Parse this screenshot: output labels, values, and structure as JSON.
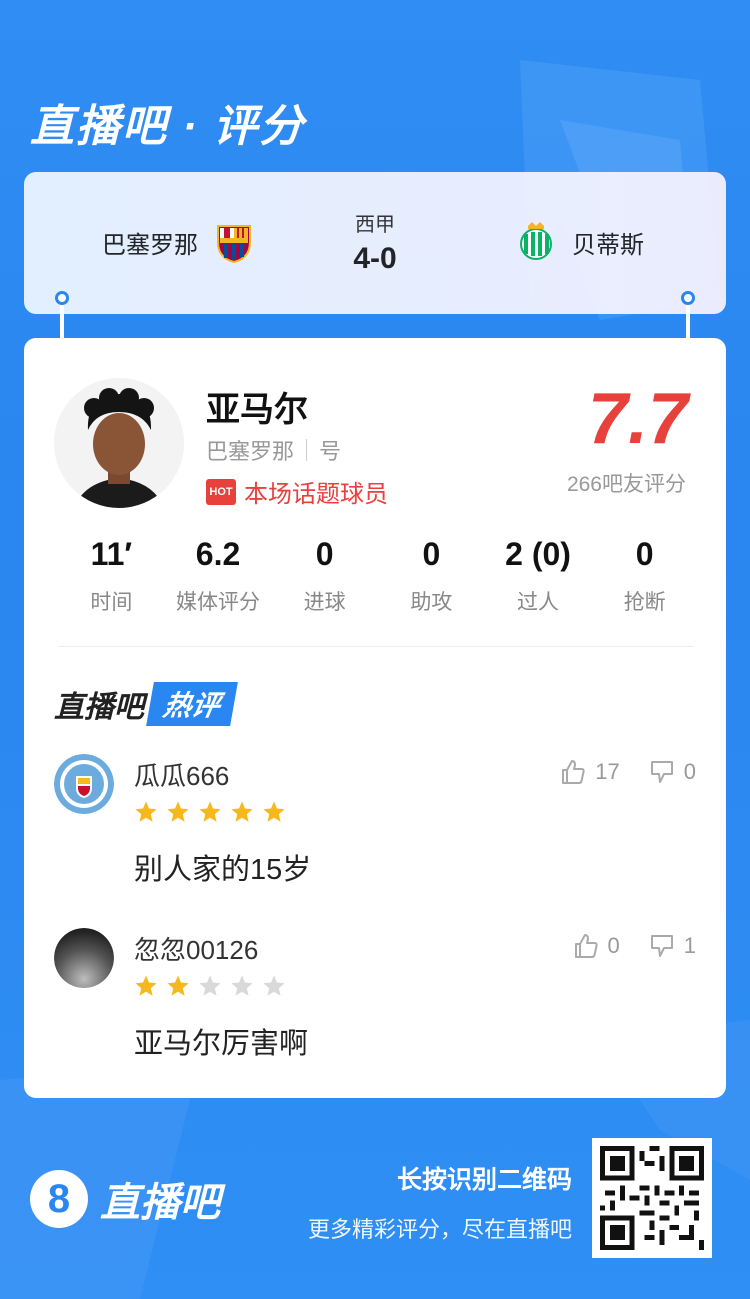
{
  "header": {
    "title": "直播吧 · 评分"
  },
  "match": {
    "home_team": "巴塞罗那",
    "away_team": "贝蒂斯",
    "league": "西甲",
    "score": "4-0"
  },
  "player": {
    "name": "亚马尔",
    "team": "巴塞罗那",
    "number_label": "号",
    "hot_badge": "HOT",
    "hot_text": "本场话题球员",
    "rating": "7.7",
    "rating_count": "266吧友评分"
  },
  "stats": [
    {
      "value": "11′",
      "label": "时间"
    },
    {
      "value": "6.2",
      "label": "媒体评分"
    },
    {
      "value": "0",
      "label": "进球"
    },
    {
      "value": "0",
      "label": "助攻"
    },
    {
      "value": "2 (0)",
      "label": "过人"
    },
    {
      "value": "0",
      "label": "抢断"
    }
  ],
  "hot_comments": {
    "title_main": "直播吧",
    "title_tag": "热评",
    "items": [
      {
        "user": "瓜瓜666",
        "stars": 5,
        "text": "别人家的15岁",
        "likes": "17",
        "dislikes": "0"
      },
      {
        "user": "忽忽00126",
        "stars": 2,
        "text": "亚马尔厉害啊",
        "likes": "0",
        "dislikes": "1"
      }
    ]
  },
  "footer": {
    "logo_number": "8",
    "logo_text": "直播吧",
    "cta_line1": "长按识别二维码",
    "cta_line2": "更多精彩评分，尽在直播吧"
  },
  "colors": {
    "accent_blue": "#2a86f0",
    "rating_red": "#e8403b",
    "star_gold": "#f6b91d",
    "star_gray": "#d9d9d9"
  }
}
